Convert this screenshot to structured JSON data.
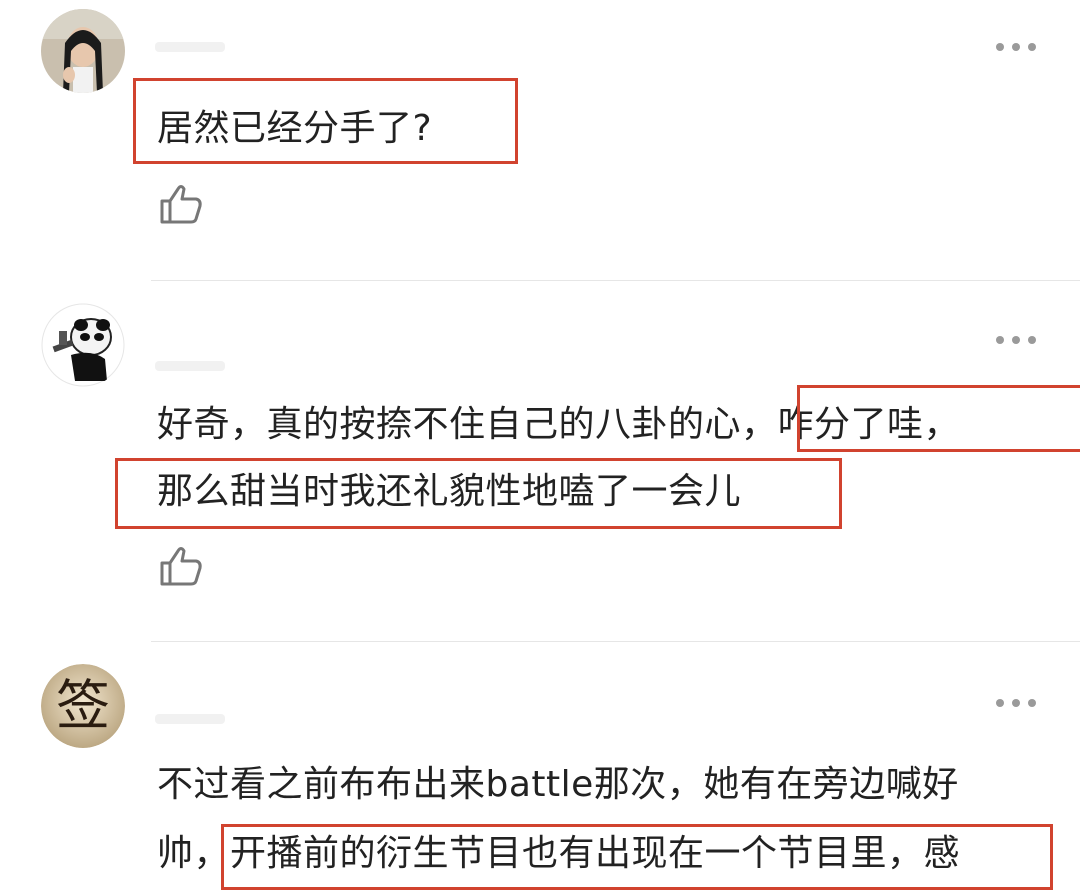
{
  "comments": [
    {
      "avatar_icon": "woman-photo-avatar",
      "lines": [
        "居然已经分手了?"
      ],
      "like_icon": "thumbs-up-icon",
      "more_icon": "more-dots-icon"
    },
    {
      "avatar_icon": "panda-meme-avatar",
      "lines": [
        "好奇，真的按捺不住自己的八卦的心，咋分了哇，",
        "那么甜当时我还礼貌性地嗑了一会儿"
      ],
      "like_icon": "thumbs-up-icon",
      "more_icon": "more-dots-icon"
    },
    {
      "avatar_icon": "chinese-character-avatar",
      "avatar_char": "签",
      "lines": [
        "不过看之前布布出来battle那次，她有在旁边喊好",
        "帅，开播前的衍生节目也有出现在一个节目里，感"
      ],
      "more_icon": "more-dots-icon"
    }
  ],
  "colors": {
    "highlight": "#d1432f",
    "text": "#222222",
    "divider": "#e6e6e6",
    "icon": "#9a9a9a"
  }
}
